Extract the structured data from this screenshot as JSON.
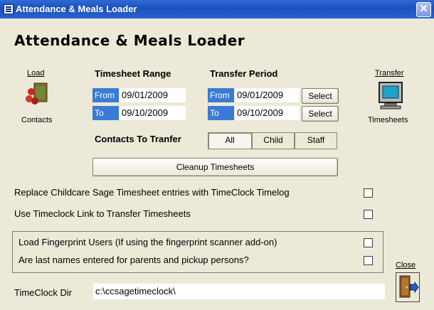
{
  "window": {
    "title": "Attendance & Meals Loader"
  },
  "heading": "Attendance & Meals Loader",
  "load": {
    "top_label": "Load",
    "bottom_label": "Contacts"
  },
  "transfer": {
    "top_label": "Transfer",
    "bottom_label": "Timesheets"
  },
  "timesheet_range": {
    "label": "Timesheet Range",
    "from_label": "From",
    "from_value": "09/01/2009",
    "to_label": "To",
    "to_value": "09/10/2009"
  },
  "transfer_period": {
    "label": "Transfer Period",
    "from_label": "From",
    "from_value": "09/01/2009",
    "to_label": "To",
    "to_value": "09/10/2009",
    "select_label": "Select"
  },
  "contacts": {
    "label": "Contacts To Tranfer",
    "options": [
      "All",
      "Child",
      "Staff"
    ],
    "selected": "All"
  },
  "cleanup_label": "Cleanup Timesheets",
  "options": {
    "replace": "Replace Childcare Sage Timesheet entries with TimeClock Timelog",
    "link": "Use Timeclock Link to Transfer Timesheets",
    "fingerprint": "Load Fingerprint Users (If using the fingerprint scanner add-on)",
    "lastnames": "Are last names entered for parents and pickup persons?"
  },
  "timeclock": {
    "label": "TimeClock Dir",
    "value": "c:\\ccsagetimeclock\\"
  },
  "close_label": "Close",
  "colors": {
    "title_bar": "#1B4FBF",
    "field_label_bg": "#3A7BD5",
    "window_bg": "#ECE9D8"
  }
}
